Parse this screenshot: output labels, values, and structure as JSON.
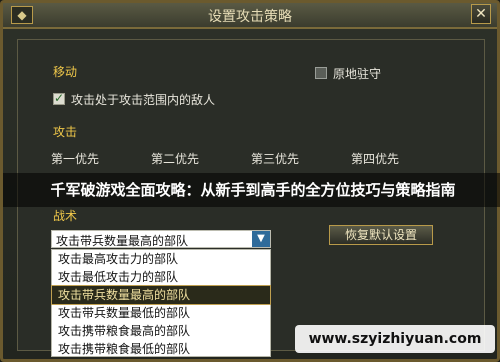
{
  "window": {
    "title": "设置攻击策略",
    "close_icon": "close-icon"
  },
  "movement": {
    "section_label": "移动",
    "attack_in_range_label": "攻击处于攻击范围内的敌人",
    "attack_in_range_checked": true,
    "stay_put_label": "原地驻守",
    "stay_put_checked": false
  },
  "attack": {
    "section_label": "攻击",
    "priorities": [
      "第一优先",
      "第二优先",
      "第三优先",
      "第四优先"
    ]
  },
  "banner": {
    "text": "千军破游戏全面攻略：从新手到高手的全方位技巧与策略指南"
  },
  "tactics": {
    "section_label": "战术",
    "selected": "攻击带兵数量最高的部队",
    "options": [
      "攻击最高攻击力的部队",
      "攻击最低攻击力的部队",
      "攻击带兵数量最高的部队",
      "攻击带兵数量最低的部队",
      "攻击携带粮食最高的部队",
      "攻击携带粮食最低的部队"
    ]
  },
  "buttons": {
    "restore_default": "恢复默认设置"
  },
  "watermark": {
    "text": "www.szyizhiyuan.com"
  }
}
